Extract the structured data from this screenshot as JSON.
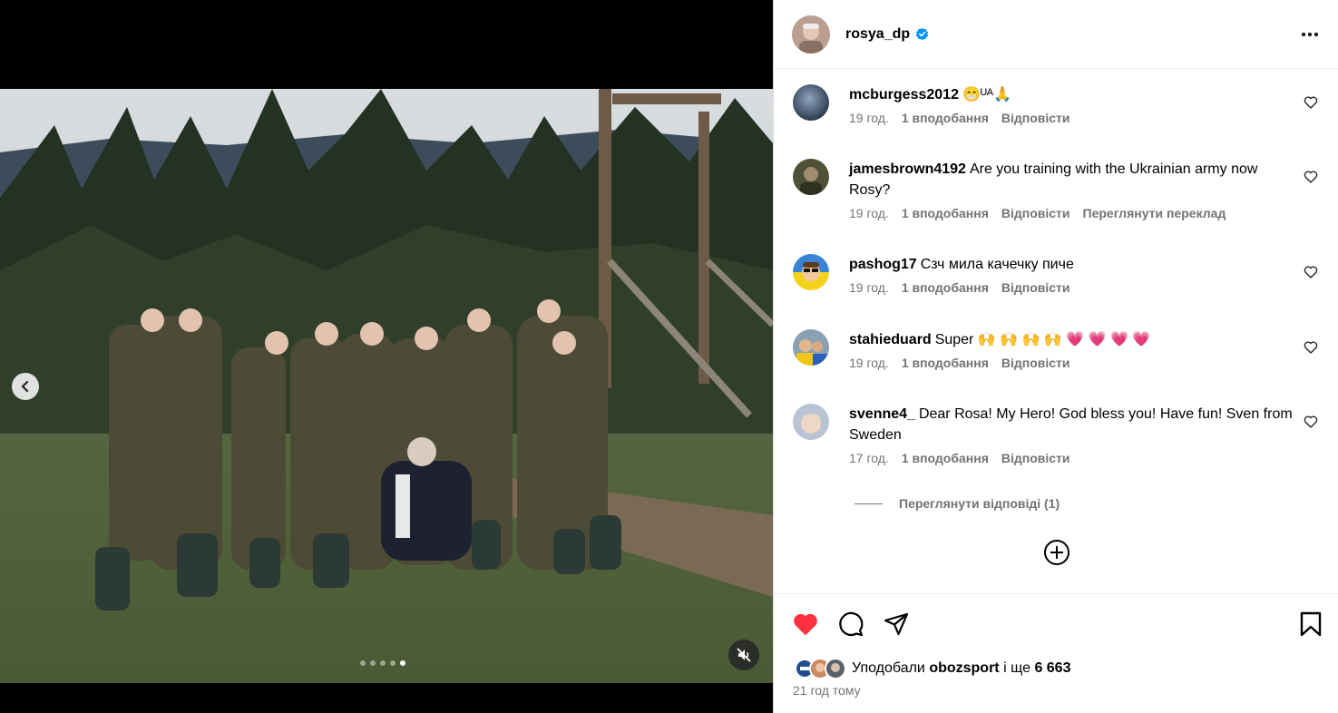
{
  "post": {
    "username": "rosya_dp",
    "verified": true,
    "more_icon": "more-horizontal-icon",
    "media_slide_count": 5,
    "media_active_slide": 5,
    "muted": true
  },
  "comments": [
    {
      "username": "mcburgess2012",
      "text": "😁ᵁᴬ🙏",
      "time": "19 год.",
      "likes": "1 вподобання",
      "reply": "Відповісти",
      "translate": ""
    },
    {
      "username": "jamesbrown4192",
      "text": "Are you training with the Ukrainian army now Rosy?",
      "time": "19 год.",
      "likes": "1 вподобання",
      "reply": "Відповісти",
      "translate": "Переглянути переклад"
    },
    {
      "username": "pashog17",
      "text": "Сзч мила качечку пиче",
      "time": "19 год.",
      "likes": "1 вподобання",
      "reply": "Відповісти",
      "translate": ""
    },
    {
      "username": "stahieduard",
      "text": "Super 🙌 🙌 🙌 🙌 💗 💗 💗 💗",
      "time": "19 год.",
      "likes": "1 вподобання",
      "reply": "Відповісти",
      "translate": ""
    },
    {
      "username": "svenne4_",
      "text": "Dear Rosa! My Hero! God bless you! Have fun! Sven from Sweden",
      "time": "17 год.",
      "likes": "1 вподобання",
      "reply": "Відповісти",
      "translate": ""
    }
  ],
  "replies_link": "Переглянути відповіді (1)",
  "footer": {
    "liked_by_prefix": "Уподобали",
    "liked_by_user": "obozsport",
    "liked_by_suffix": "і ще",
    "like_count": "6 663",
    "timestamp": "21 год тому",
    "liked": true
  },
  "colors": {
    "like_red": "#ff3040",
    "verified_blue": "#0095f6",
    "meta_gray": "#737373"
  }
}
